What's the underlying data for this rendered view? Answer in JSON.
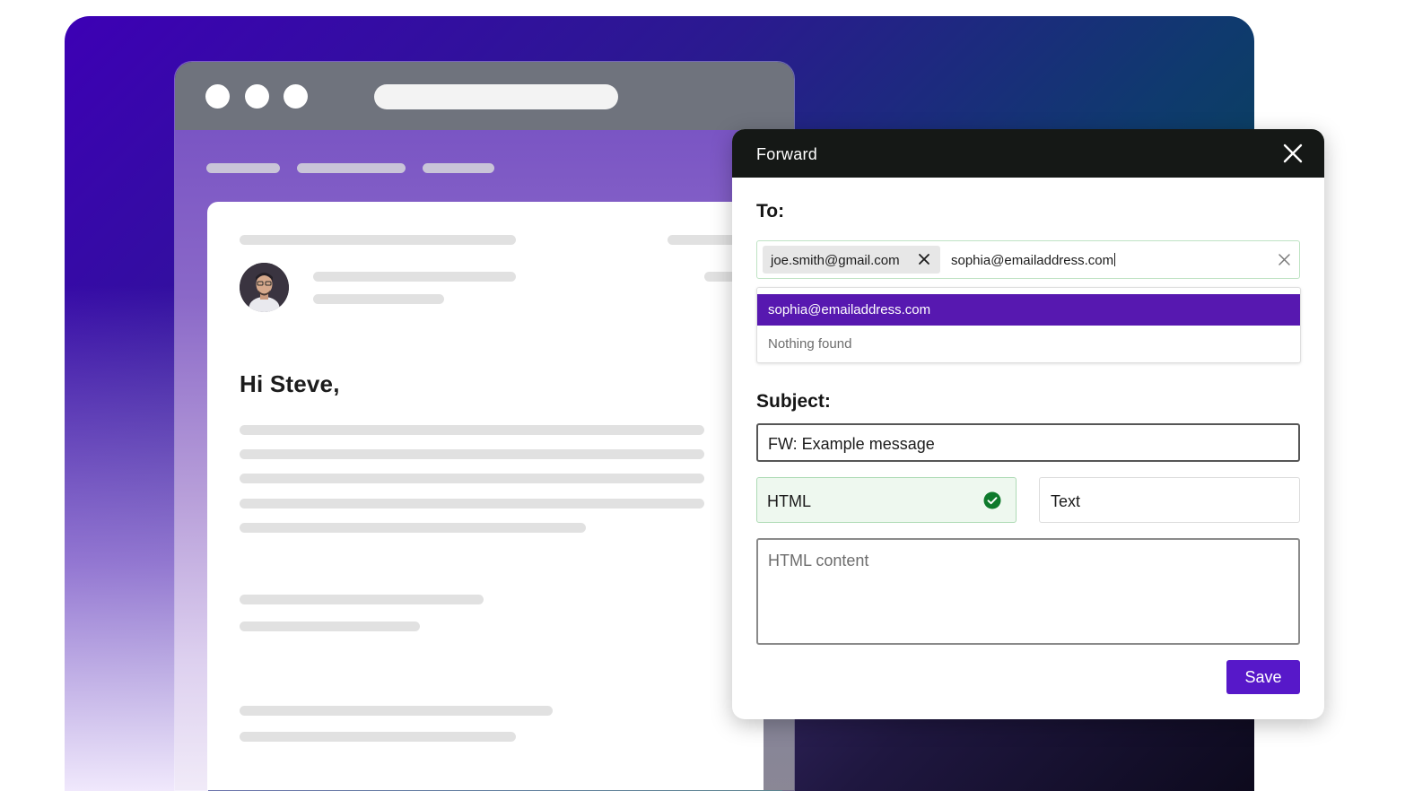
{
  "email": {
    "greeting": "Hi Steve,",
    "avatar": "person-avatar"
  },
  "dialog": {
    "title": "Forward",
    "to_label": "To:",
    "recipient_chip": "joe.smith@gmail.com",
    "to_input_value": "sophia@emailaddress.com",
    "suggestion": "sophia@emailaddress.com",
    "no_results": "Nothing found",
    "subject_label": "Subject:",
    "subject_value": "FW: Example message",
    "format_html": "HTML",
    "format_text": "Text",
    "selected_format": "HTML",
    "content_placeholder": "HTML content",
    "save_label": "Save"
  },
  "icons": {
    "close": "close-icon",
    "chip_remove": "remove-chip-icon",
    "clear": "clear-input-icon",
    "selected": "check-circle-icon"
  },
  "colors": {
    "accent": "#5718c9",
    "dropdown_highlight": "#5718b0",
    "selected_green": "#0e7a2c",
    "header_dark": "#151816"
  }
}
